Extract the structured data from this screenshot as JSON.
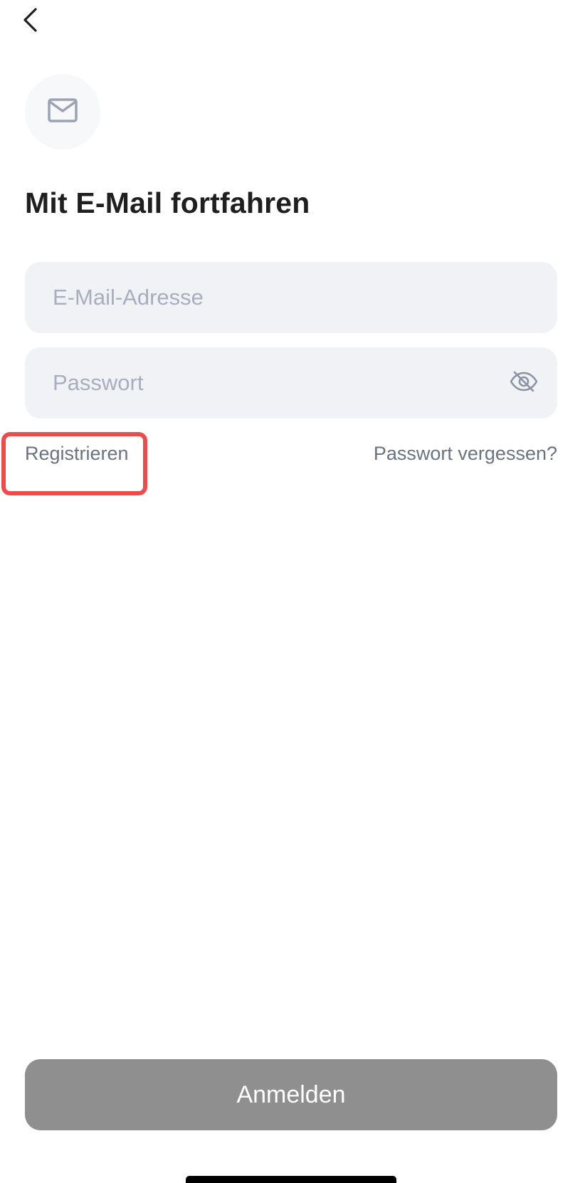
{
  "header": {
    "back_icon": "chevron-left-icon"
  },
  "badge": {
    "icon": "mail-icon"
  },
  "title": "Mit E-Mail fortfahren",
  "form": {
    "email": {
      "value": "",
      "placeholder": "E-Mail-Adresse"
    },
    "password": {
      "value": "",
      "placeholder": "Passwort",
      "toggle_icon": "eye-off-icon"
    }
  },
  "links": {
    "register": "Registrieren",
    "forgot_password": "Passwort vergessen?"
  },
  "primary_button": {
    "label": "Anmelden",
    "disabled": true
  },
  "colors": {
    "highlight": "#ee4b4b",
    "button_disabled": "#8f8f8f",
    "field_background": "#f1f2f6",
    "placeholder": "#a8aebd",
    "link_text": "#6b7280"
  }
}
